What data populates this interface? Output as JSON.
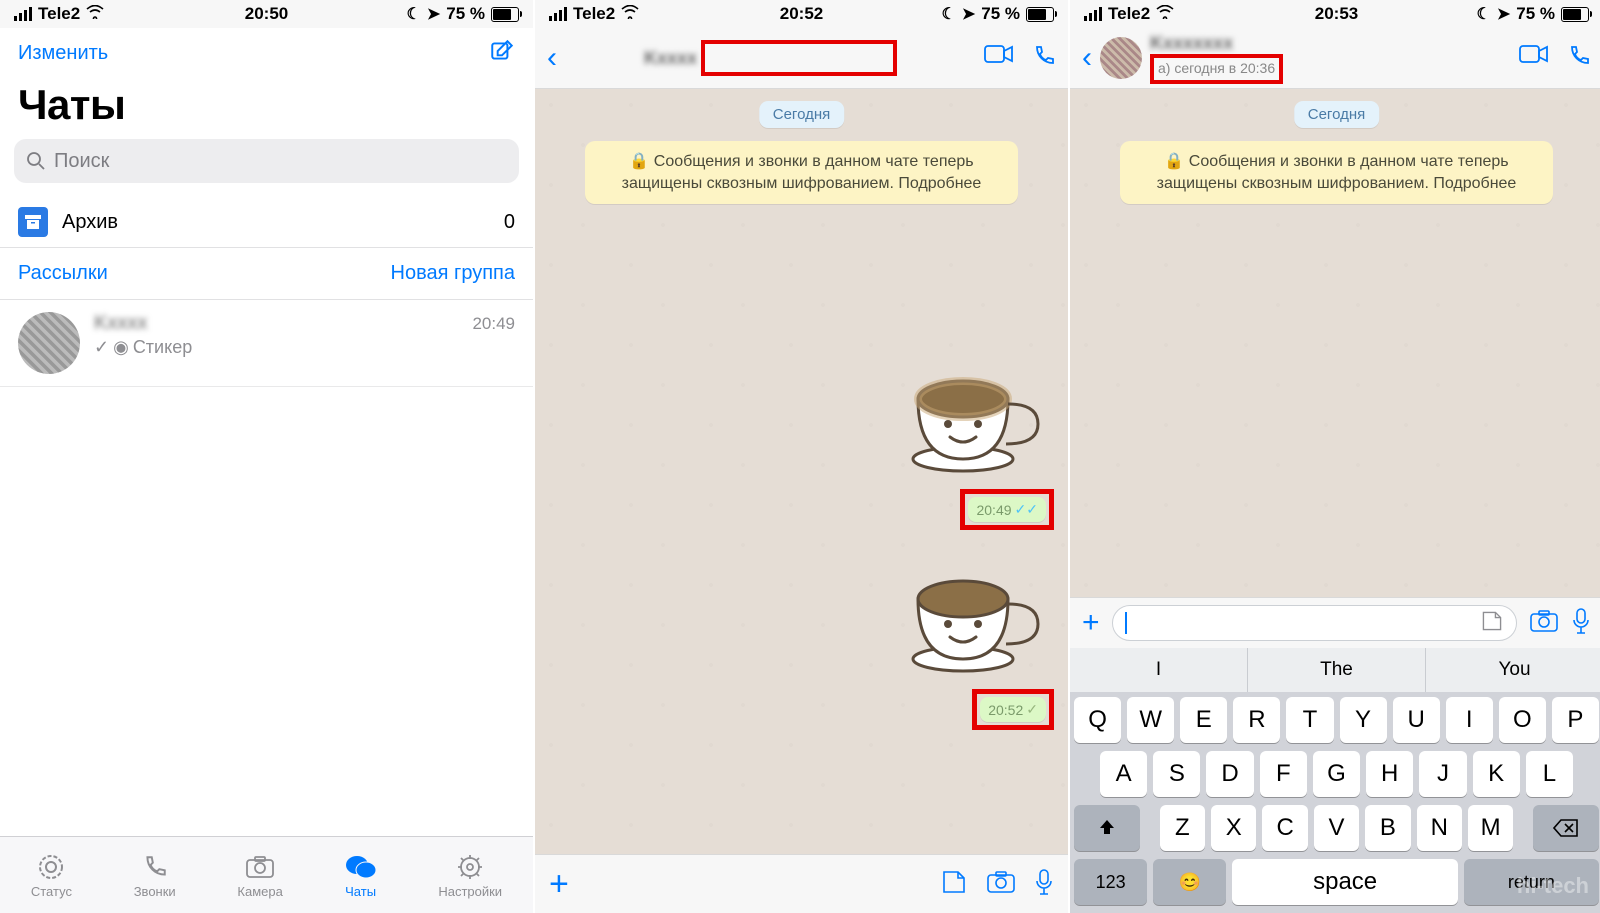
{
  "status": {
    "carrier": "Tele2",
    "battery": "75 %"
  },
  "screen1": {
    "time": "20:50",
    "edit": "Изменить",
    "title": "Чаты",
    "search_ph": "Поиск",
    "archive": "Архив",
    "archive_count": "0",
    "broadcasts": "Рассылки",
    "new_group": "Новая группа",
    "chat": {
      "name": "Kxxxx",
      "last": "Стикер",
      "time": "20:49"
    },
    "tabs": {
      "status": "Статус",
      "calls": "Звонки",
      "camera": "Камера",
      "chats": "Чаты",
      "settings": "Настройки"
    }
  },
  "screen2": {
    "time": "20:52",
    "date_pill": "Сегодня",
    "encryption": "🔒 Сообщения и звонки в данном чате теперь защищены сквозным шифрованием. Подробнее",
    "msgs": [
      {
        "time": "20:49",
        "read": true
      },
      {
        "time": "20:52",
        "read": false
      }
    ]
  },
  "screen3": {
    "time": "20:53",
    "header_sub": "а) сегодня в 20:36",
    "date_pill": "Сегодня",
    "encryption": "🔒 Сообщения и звонки в данном чате теперь защищены сквозным шифрованием. Подробнее",
    "suggestions": [
      "I",
      "The",
      "You"
    ],
    "kb_rows": [
      [
        "Q",
        "W",
        "E",
        "R",
        "T",
        "Y",
        "U",
        "I",
        "O",
        "P"
      ],
      [
        "A",
        "S",
        "D",
        "F",
        "G",
        "H",
        "J",
        "K",
        "L"
      ],
      [
        "Z",
        "X",
        "C",
        "V",
        "B",
        "N",
        "M"
      ]
    ],
    "kb_bottom": {
      "num": "123",
      "space": "space",
      "ret": "return"
    }
  },
  "watermark": "hi-tech"
}
